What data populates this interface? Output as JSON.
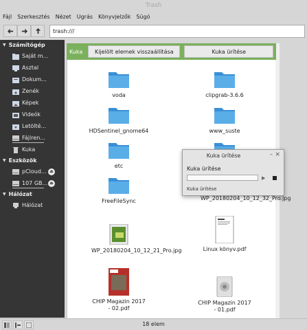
{
  "window": {
    "title": "Trash"
  },
  "menu": [
    "Fájl",
    "Szerkesztés",
    "Nézet",
    "Ugrás",
    "Könyvjelzők",
    "Súgó"
  ],
  "location": {
    "value": "trash:///"
  },
  "sidebar": {
    "computer": {
      "title": "Számítógép",
      "items": [
        "Saját m...",
        "Asztal",
        "Dokum...",
        "Zenék",
        "Képek",
        "Videók",
        "Letölté...",
        "Fájlren...",
        "Kuka"
      ]
    },
    "devices": {
      "title": "Eszközök",
      "items": [
        "pCloud...",
        "107 GB..."
      ]
    },
    "network": {
      "title": "Hálózat",
      "items": [
        "Hálózat"
      ]
    }
  },
  "trashbar": {
    "label": "Kuka",
    "restore": "Kijelölt elemek visszaállítása",
    "empty": "Kuka ürítése"
  },
  "files": [
    {
      "name": "voda",
      "type": "folder"
    },
    {
      "name": "clipgrab-3.6.6",
      "type": "folder"
    },
    {
      "name": "HDSentinel_gnome64",
      "type": "folder"
    },
    {
      "name": "www_suste",
      "type": "folder"
    },
    {
      "name": "etc",
      "type": "folder"
    },
    {
      "name": "",
      "type": "folder"
    },
    {
      "name": "FreeFileSync",
      "type": "folder"
    },
    {
      "name": "WP_20180204_10_12_32_Pro.jpg",
      "type": "image"
    },
    {
      "name": "WP_20180204_10_12_21_Pro.jpg",
      "type": "image"
    },
    {
      "name": "Linux könyv.pdf",
      "type": "pdf"
    },
    {
      "name": "CHIP Magazin 2017 - 02.pdf",
      "type": "pdf"
    },
    {
      "name": "CHIP Magazin 2017 - 01.pdf",
      "type": "pdf"
    }
  ],
  "status": {
    "count": "18 elem"
  },
  "dialog": {
    "title": "Kuka ürítése",
    "label": "Kuka ürítése",
    "sub": "Kuka ürítése",
    "progress": 0
  }
}
